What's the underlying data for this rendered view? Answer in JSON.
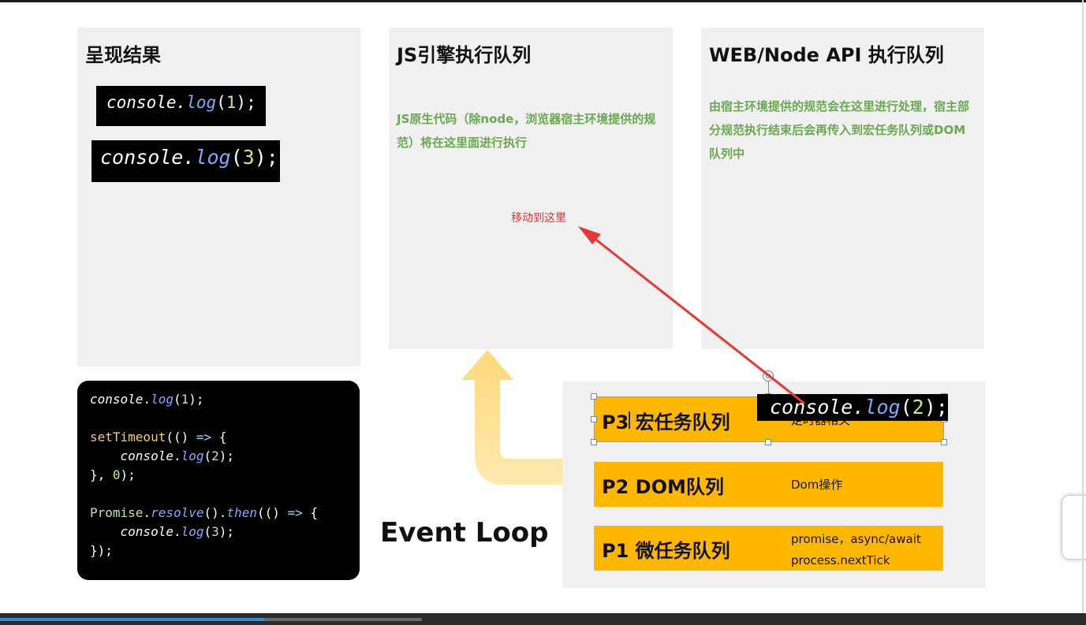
{
  "panels": {
    "result": {
      "title": "呈现结果"
    },
    "js_engine": {
      "title": "JS引擎执行队列",
      "note": "JS原生代码（除node，浏览器宿主环境提供的规范）将在这里面进行执行"
    },
    "web_api": {
      "title": "WEB/Node API 执行队列",
      "note": "由宿主环境提供的规范会在这里进行处理，宿主部分规范执行结束后会再传入到宏任务队列或DOM队列中"
    }
  },
  "result_chips": [
    {
      "obj": "console",
      "dot": ".",
      "method": "log",
      "open": "(",
      "arg": "1",
      "close": ");"
    },
    {
      "obj": "console",
      "dot": ".",
      "method": "log",
      "open": "(",
      "arg": "3",
      "close": ");"
    }
  ],
  "dragged_chip": {
    "obj": "console",
    "dot": ".",
    "method": "log",
    "open": "(",
    "arg": "2",
    "close": ");"
  },
  "annotation": {
    "text": "移动到这里",
    "color": "#e53935"
  },
  "code": {
    "l1_obj": "console",
    "l1_dot": ".",
    "l1_meth": "log",
    "l1_open": "(",
    "l1_num": "1",
    "l1_close": ");",
    "l3_fn": "setTimeout",
    "l3_open": "(() ",
    "l3_arrow": "=>",
    "l3_brace": " {",
    "l4_indent": "    ",
    "l4_obj": "console",
    "l4_dot": ".",
    "l4_meth": "log",
    "l4_open": "(",
    "l4_num": "2",
    "l4_close": ");",
    "l5_close": "}, ",
    "l5_num": "0",
    "l5_end": ");",
    "l7_cls": "Promise",
    "l7_dot": ".",
    "l7_resolve": "resolve",
    "l7_mid": "().",
    "l7_then": "then",
    "l7_open": "(() ",
    "l7_arrow": "=>",
    "l7_brace": " {",
    "l8_indent": "    ",
    "l8_obj": "console",
    "l8_dot": ".",
    "l8_meth": "log",
    "l8_open": "(",
    "l8_num": "3",
    "l8_close": ");",
    "l9_close": "});"
  },
  "queues": [
    {
      "label": "P3 宏任务队列",
      "desc": [
        "定时器相关"
      ]
    },
    {
      "label": "P2 DOM队列",
      "desc": [
        "Dom操作"
      ]
    },
    {
      "label": "P1 微任务队列",
      "desc": [
        "promise，async/await",
        "process.nextTick"
      ]
    }
  ],
  "event_loop_label": "Event Loop",
  "colors": {
    "panel_bg": "#f0f0f0",
    "queue_bar": "#ffb700",
    "green_note": "#6aa84f",
    "arrow_red": "#e53935",
    "loop_arrow": "#ffd97a",
    "code_bg": "#000000",
    "progress": "#2e8fd6"
  },
  "video_progress": 0.24
}
